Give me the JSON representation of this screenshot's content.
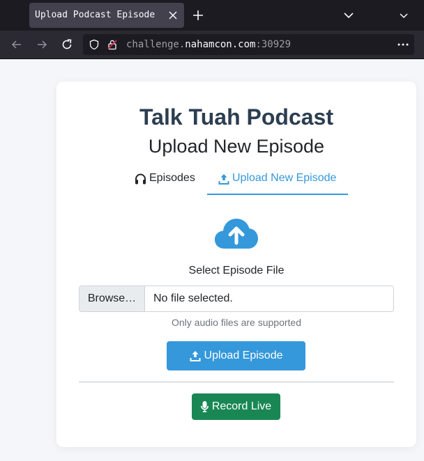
{
  "browser": {
    "tab_title": "Upload Podcast Episode",
    "url_prefix": "challenge.",
    "url_host": "nahamcon.com",
    "url_port": ":30929"
  },
  "page": {
    "site_title": "Talk Tuah Podcast",
    "subtitle": "Upload New Episode",
    "nav": {
      "episodes_label": "Episodes",
      "upload_label": "Upload New Episode"
    },
    "select_label": "Select Episode File",
    "browse_label": "Browse…",
    "file_status": "No file selected.",
    "help_text": "Only audio files are supported",
    "upload_button": "Upload Episode",
    "record_button": "Record Live"
  },
  "colors": {
    "accent": "#3498db",
    "success": "#198754",
    "title": "#2c3e50"
  }
}
